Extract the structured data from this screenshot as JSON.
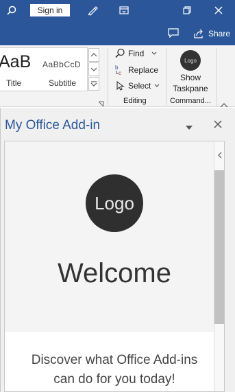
{
  "titlebar": {
    "signin_label": "Sign in",
    "icons": [
      "search-icon",
      "pen-icon",
      "ribbon-display-icon",
      "restore-icon",
      "close-icon"
    ],
    "share_label": "Share"
  },
  "ribbon": {
    "styles": {
      "title_sample": "AaB",
      "title_label": "Title",
      "subtitle_sample": "AaBbCcD",
      "subtitle_label": "Subtitle"
    },
    "editing": {
      "find_label": "Find",
      "replace_label": "Replace",
      "select_label": "Select",
      "group_label": "Editing"
    },
    "commands": {
      "logo_text": "Logo",
      "show_taskpane_line1": "Show",
      "show_taskpane_line2": "Taskpane",
      "group_label": "Command..."
    }
  },
  "taskpane": {
    "title": "My Office Add-in",
    "logo_text": "Logo",
    "welcome": "Welcome",
    "discover_line1": "Discover what Office Add-ins",
    "discover_line2": "can do for you today!"
  },
  "colors": {
    "titlebar_bg": "#2b579a",
    "pane_title": "#2b579a",
    "logo_bg": "#2f2f2f"
  }
}
